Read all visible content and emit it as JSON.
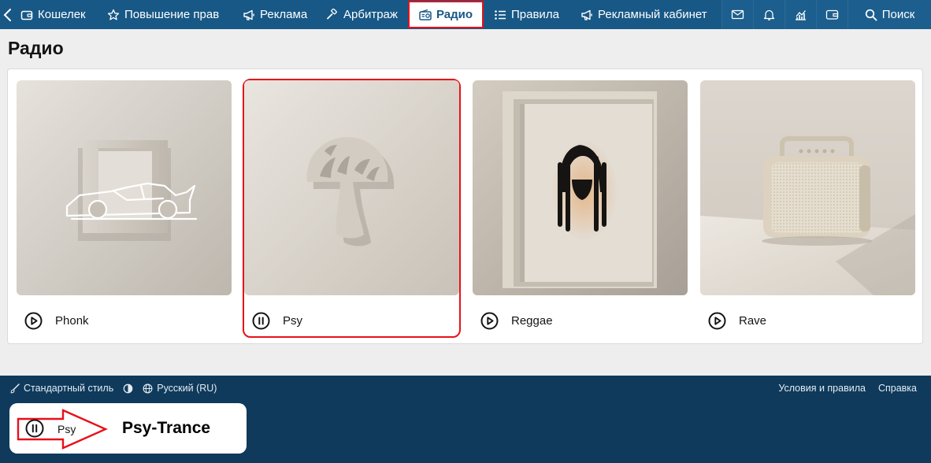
{
  "nav": {
    "items": [
      {
        "label": "Кошелек",
        "icon": "wallet-icon"
      },
      {
        "label": "Повышение прав",
        "icon": "star-icon"
      },
      {
        "label": "Реклама",
        "icon": "megaphone-icon"
      },
      {
        "label": "Арбитраж",
        "icon": "gavel-icon"
      },
      {
        "label": "Радио",
        "icon": "radio-icon",
        "active": true
      },
      {
        "label": "Правила",
        "icon": "list-icon"
      },
      {
        "label": "Рекламный кабинет",
        "icon": "megaphone-icon"
      }
    ],
    "search_label": "Поиск",
    "accent_color": "#185886",
    "highlight_color": "#e8101a"
  },
  "page": {
    "title": "Радио"
  },
  "stations": [
    {
      "label": "Phonk",
      "image": "sports-car-illustration",
      "state": "play"
    },
    {
      "label": "Psy",
      "image": "mushroom-illustration",
      "state": "pause",
      "selected": true
    },
    {
      "label": "Reggae",
      "image": "dreadlocks-illustration",
      "state": "play"
    },
    {
      "label": "Rave",
      "image": "boombox-speaker-illustration",
      "state": "play"
    }
  ],
  "footer": {
    "style_label": "Стандартный стиль",
    "language_label": "Русский (RU)",
    "terms_label": "Условия и правила",
    "help_label": "Справка",
    "background_color": "#0f3a5b"
  },
  "player": {
    "station_label": "Psy",
    "title": "Psy-Trance",
    "state": "pause"
  }
}
